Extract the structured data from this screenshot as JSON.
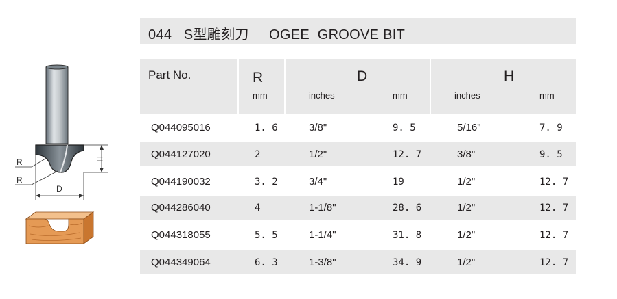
{
  "title": {
    "number": "044",
    "chinese": "S型雕刻刀",
    "english": "OGEE  GROOVE BIT"
  },
  "header": {
    "part_no": "Part No.",
    "r": {
      "symbol": "R",
      "unit": "mm"
    },
    "d": {
      "symbol": "D",
      "units": [
        "inches",
        "mm"
      ]
    },
    "h": {
      "symbol": "H",
      "units": [
        "inches",
        "mm"
      ]
    }
  },
  "rows": [
    {
      "part": "Q044095016",
      "r": "1. 6",
      "d_in": "3/8\"",
      "d_mm": "9. 5",
      "h_in": "5/16\"",
      "h_mm": "7. 9"
    },
    {
      "part": "Q044127020",
      "r": "2",
      "d_in": "1/2\"",
      "d_mm": "12. 7",
      "h_in": "3/8\"",
      "h_mm": "9. 5"
    },
    {
      "part": "Q044190032",
      "r": "3. 2",
      "d_in": "3/4\"",
      "d_mm": "19",
      "h_in": "1/2\"",
      "h_mm": "12. 7"
    },
    {
      "part": "Q044286040",
      "r": "4",
      "d_in": "1-1/8\"",
      "d_mm": "28. 6",
      "h_in": "1/2\"",
      "h_mm": "12. 7"
    },
    {
      "part": "Q044318055",
      "r": "5. 5",
      "d_in": "1-1/4\"",
      "d_mm": "31. 8",
      "h_in": "1/2\"",
      "h_mm": "12. 7"
    },
    {
      "part": "Q044349064",
      "r": "6. 3",
      "d_in": "1-3/8\"",
      "d_mm": "34. 9",
      "h_in": "1/2\"",
      "h_mm": "12. 7"
    }
  ],
  "diagram_labels": {
    "r1": "R",
    "r2": "R",
    "d": "D",
    "h": "H"
  },
  "colors": {
    "header_bg": "#e8e8e8",
    "text": "#231f20",
    "wood": "#e59a55"
  }
}
